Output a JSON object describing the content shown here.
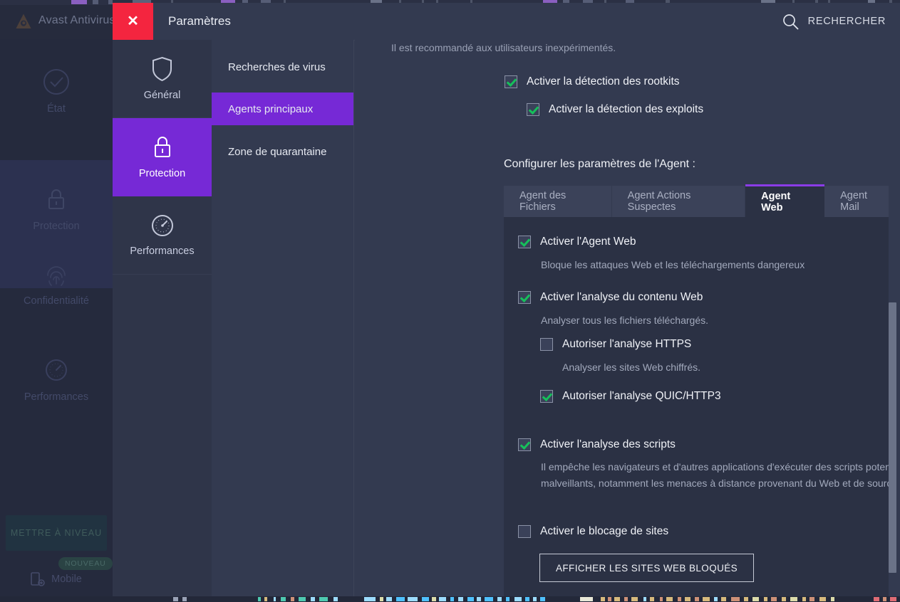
{
  "background_app": {
    "title": "Avast Antivirus",
    "nav_items": [
      {
        "label": "État",
        "icon": "check-circle-icon"
      },
      {
        "label": "Protection",
        "icon": "lock-icon"
      },
      {
        "label": "Confidentialité",
        "icon": "fingerprint-icon"
      },
      {
        "label": "Performances",
        "icon": "speedometer-icon"
      }
    ],
    "upgrade_button": "METTRE À NIVEAU",
    "new_badge": "NOUVEAU",
    "mobile_label": "Mobile"
  },
  "dialog": {
    "title": "Paramètres",
    "close_icon": "close-icon",
    "search": {
      "label": "RECHERCHER",
      "icon": "search-icon"
    },
    "primary_nav": [
      {
        "label": "Général",
        "icon": "shield-icon",
        "active": false
      },
      {
        "label": "Protection",
        "icon": "lock-icon",
        "active": true
      },
      {
        "label": "Performances",
        "icon": "speedometer-icon",
        "active": false
      }
    ],
    "sub_nav": [
      {
        "label": "Recherches de virus",
        "active": false
      },
      {
        "label": "Agents principaux",
        "active": true
      },
      {
        "label": "Zone de quarantaine",
        "active": false
      }
    ]
  },
  "content": {
    "hint": "Il est recommandé aux utilisateurs inexpérimentés.",
    "rootkits": {
      "label": "Activer la détection des rootkits",
      "checked": true
    },
    "exploits": {
      "label": "Activer la détection des exploits",
      "checked": true
    },
    "agent_section_title": "Configurer les paramètres de l'Agent :",
    "tabs": [
      {
        "label": "Agent des Fichiers",
        "active": false
      },
      {
        "label": "Agent Actions Suspectes",
        "active": false
      },
      {
        "label": "Agent Web",
        "active": true
      },
      {
        "label": "Agent Mail",
        "active": false
      }
    ],
    "web_agent": {
      "enable": {
        "label": "Activer l'Agent Web",
        "checked": true,
        "desc": "Bloque les attaques Web et les téléchargements dangereux"
      },
      "content_scan": {
        "label": "Activer l'analyse du contenu Web",
        "checked": true,
        "desc": "Analyser tous les fichiers téléchargés."
      },
      "https_scan": {
        "label": "Autoriser l'analyse HTTPS",
        "checked": false,
        "desc": "Analyser les sites Web chiffrés."
      },
      "quic_scan": {
        "label": "Autoriser l'analyse QUIC/HTTP3",
        "checked": true
      },
      "script_scan": {
        "label": "Activer l'analyse des scripts",
        "checked": true,
        "desc": "Il empêche les navigateurs et d'autres applications d'exécuter des scripts potentiellement malveillants, notamment les menaces à distance provenant du Web et de sources extérieures."
      },
      "site_blocking": {
        "label": "Activer le blocage de sites",
        "checked": false
      },
      "blocked_sites_button": "AFFICHER LES SITES WEB BLOQUÉS"
    }
  },
  "colors": {
    "accent_purple": "#7629d6",
    "tab_accent": "#8b3ce8",
    "close_red": "#f4253f",
    "check_green": "#16c05b",
    "dialog_bg": "#333a50",
    "panel_bg": "#2b3144"
  }
}
